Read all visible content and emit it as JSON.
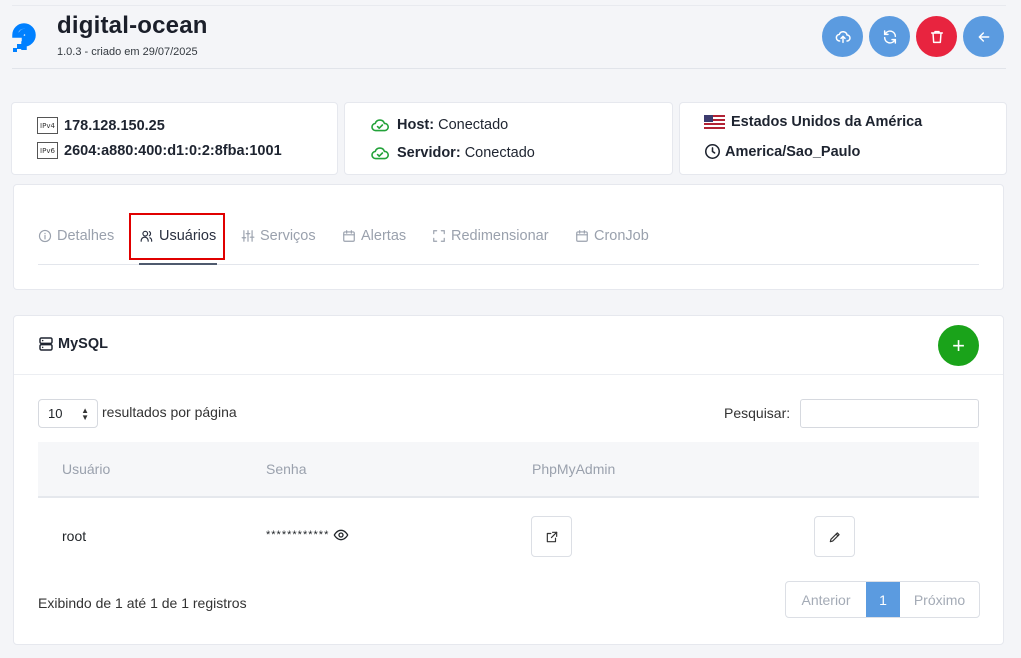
{
  "header": {
    "title": "digital-ocean",
    "subtitle": "1.0.3 - criado em 29/07/2025"
  },
  "actions": {
    "upload_color": "#5b9be0",
    "refresh_color": "#5b9be0",
    "delete_color": "#e8243f",
    "back_color": "#5b9be0"
  },
  "network": {
    "ipv4_badge": "IPv4",
    "ipv4": "178.128.150.25",
    "ipv6_badge": "IPv6",
    "ipv6": "2604:a880:400:d1:0:2:8fba:1001"
  },
  "status": {
    "host_label": "Host:",
    "host_value": "Conectado",
    "server_label": "Servidor:",
    "server_value": "Conectado"
  },
  "location": {
    "country": "Estados Unidos da América",
    "timezone": "America/Sao_Paulo"
  },
  "tabs": [
    {
      "label": "Detalhes",
      "icon": "info-icon"
    },
    {
      "label": "Usuários",
      "icon": "users-icon",
      "active": true
    },
    {
      "label": "Serviços",
      "icon": "sliders-icon"
    },
    {
      "label": "Alertas",
      "icon": "calendar-icon"
    },
    {
      "label": "Redimensionar",
      "icon": "resize-icon"
    },
    {
      "label": "CronJob",
      "icon": "calendar-icon"
    }
  ],
  "section": {
    "title": "MySQL",
    "add_label": "+"
  },
  "table": {
    "page_size": "10",
    "per_page_label": "resultados por página",
    "search_label": "Pesquisar:",
    "search_value": "",
    "columns": [
      "Usuário",
      "Senha",
      "PhpMyAdmin"
    ],
    "rows": [
      {
        "user": "root",
        "password": "************"
      }
    ],
    "footer": "Exibindo de 1 até 1 de 1 registros",
    "prev": "Anterior",
    "current_page": "1",
    "next": "Próximo"
  }
}
